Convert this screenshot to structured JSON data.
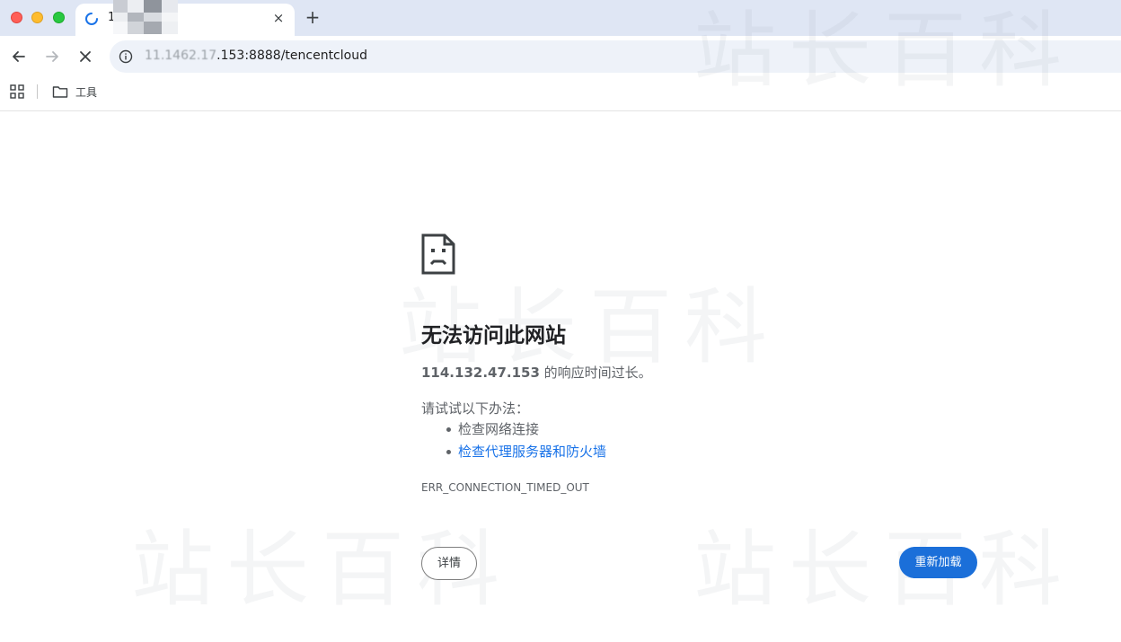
{
  "browser": {
    "tab": {
      "title": "1",
      "close_glyph": "×"
    },
    "new_tab_glyph": "+",
    "address_bar": {
      "url_host_obscured": "11.1462.17",
      "url_rest": ".153:8888/tencentcloud"
    },
    "bookmarks": [
      {
        "label": "工具",
        "icon": "folder-icon"
      }
    ]
  },
  "watermark": {
    "text": "站长百科"
  },
  "error_page": {
    "title": "无法访问此网站",
    "host": "114.132.47.153",
    "summary_suffix": " 的响应时间过长。",
    "suggestions_heading": "请试试以下办法：",
    "suggestions": [
      {
        "label": "检查网络连接",
        "is_link": false
      },
      {
        "label": "检查代理服务器和防火墙",
        "is_link": true
      }
    ],
    "error_code": "ERR_CONNECTION_TIMED_OUT",
    "details_button": "详情",
    "reload_button": "重新加载"
  },
  "colors": {
    "tabstrip_bg": "#dfe6f4",
    "omnibox_bg": "#eef2f9",
    "link_blue": "#1a73e8",
    "primary_button": "#1b6fd9",
    "traffic_red": "#ff5f57",
    "traffic_yellow": "#febc2e",
    "traffic_green": "#28c840"
  }
}
